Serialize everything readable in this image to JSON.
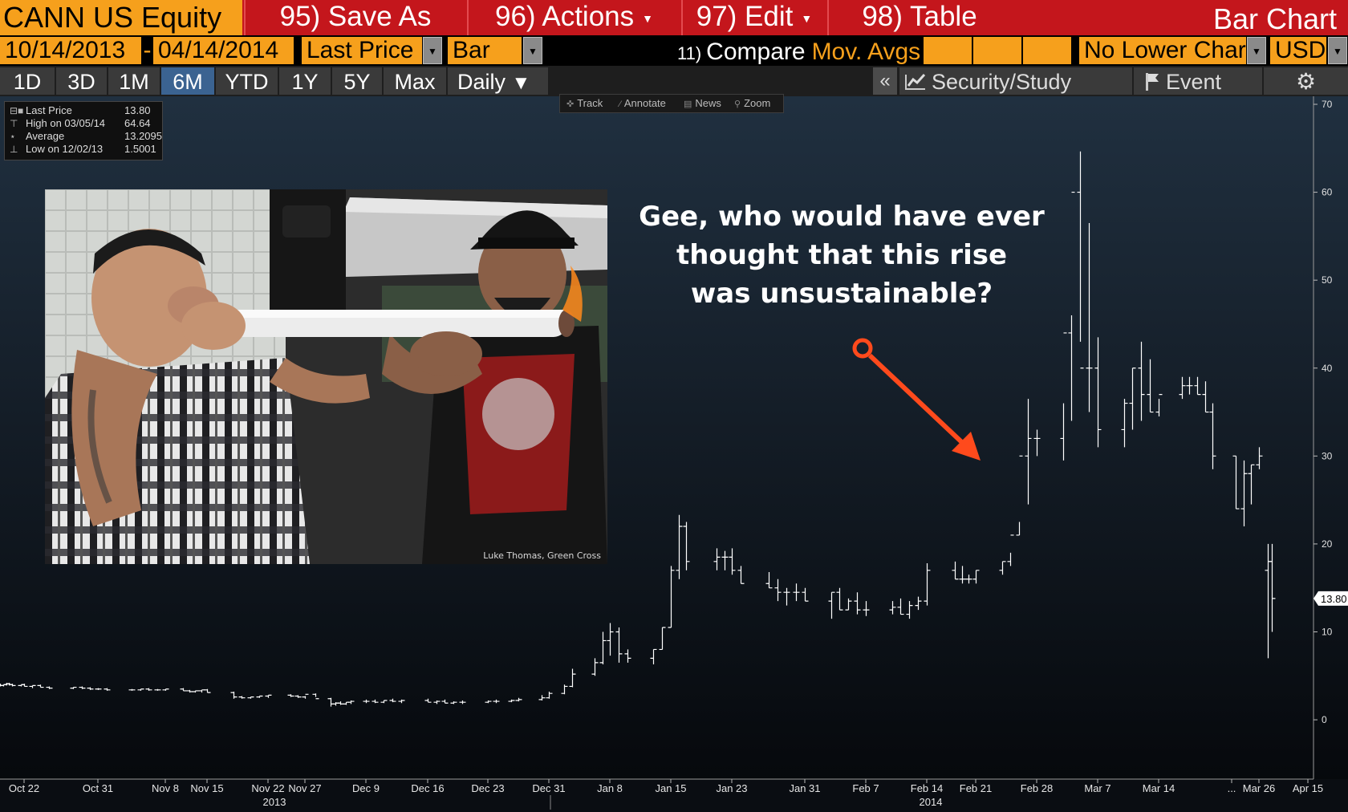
{
  "header": {
    "security": "CANN US Equity",
    "save_as": "95) Save As",
    "actions": "96) Actions",
    "edit": "97) Edit",
    "table": "98) Table",
    "chart_title": "Bar Chart"
  },
  "settings": {
    "start_date": "10/14/2013",
    "end_date": "04/14/2014",
    "field": "Last Price",
    "style": "Bar",
    "compare_num": "11)",
    "compare_label": "Compare",
    "mov_avgs": "Mov. Avgs",
    "lower_chart": "No Lower Chart",
    "currency": "USD"
  },
  "range_tabs": [
    "1D",
    "3D",
    "1M",
    "6M",
    "YTD",
    "1Y",
    "5Y",
    "Max"
  ],
  "active_tab": "6M",
  "frequency": "Daily",
  "toolbar": {
    "collapse": "«",
    "security_study": "Security/Study",
    "event": "Event",
    "settings_icon": "gear-icon"
  },
  "mini_toolbar": [
    "Track",
    "Annotate",
    "News",
    "Zoom"
  ],
  "legend": {
    "last_label": "Last Price",
    "last_value": "13.80",
    "high_label": "High on 03/05/14",
    "high_value": "64.64",
    "avg_label": "Average",
    "avg_value": "13.2095",
    "low_label": "Low on 12/02/13",
    "low_value": "1.5001"
  },
  "photo": {
    "credit": "Luke Thomas, Green Cross"
  },
  "annotation": {
    "lines": [
      "Gee, who would have ever",
      "thought that this rise",
      "was unsustainable?"
    ],
    "arrow_color": "#ff4a1c"
  },
  "colors": {
    "title_bar": "#c4161c",
    "orange": "#f6a01c",
    "active_tab": "#3b6391",
    "bar": "#ffffff"
  },
  "chart_data": {
    "type": "bar",
    "subtype": "ohlc",
    "frequency": "daily",
    "ylim": [
      -2,
      70
    ],
    "y_ticks": [
      0,
      10,
      20,
      30,
      40,
      50,
      60,
      70
    ],
    "x_tick_labels": [
      "Oct 22",
      "Oct 31",
      "Nov 8",
      "Nov 15",
      "Nov 22",
      "Nov 27",
      "Dec 9",
      "Dec 16",
      "Dec 23",
      "Dec 31",
      "Jan 8",
      "Jan 15",
      "Jan 23",
      "Jan 31",
      "Feb 7",
      "Feb 14",
      "Feb 21",
      "Feb 28",
      "Mar 7",
      "Mar 14",
      "...",
      "Mar 26",
      "Apr 15"
    ],
    "year_labels": [
      "2013",
      "2014"
    ],
    "last_price_label": "13.80",
    "grid": false,
    "series": [
      {
        "x": [
          "2013-10-14",
          "2013-10-15",
          "2013-10-16",
          "2013-10-17",
          "2013-10-18",
          "2013-10-21",
          "2013-10-22",
          "2013-10-23",
          "2013-10-24",
          "2013-10-25",
          "2013-10-28",
          "2013-10-29",
          "2013-10-30",
          "2013-10-31",
          "2013-11-01",
          "2013-11-04",
          "2013-11-05",
          "2013-11-06",
          "2013-11-07",
          "2013-11-08",
          "2013-11-11",
          "2013-11-12",
          "2013-11-13",
          "2013-11-14",
          "2013-11-15",
          "2013-11-18",
          "2013-11-19",
          "2013-11-20",
          "2013-11-21",
          "2013-11-22",
          "2013-11-25",
          "2013-11-26",
          "2013-11-27",
          "2013-11-29",
          "2013-12-02",
          "2013-12-03",
          "2013-12-04",
          "2013-12-05",
          "2013-12-06",
          "2013-12-09",
          "2013-12-10",
          "2013-12-11",
          "2013-12-12",
          "2013-12-13",
          "2013-12-16",
          "2013-12-17",
          "2013-12-18",
          "2013-12-19",
          "2013-12-20",
          "2013-12-23",
          "2013-12-24",
          "2013-12-26",
          "2013-12-27",
          "2013-12-30",
          "2013-12-31",
          "2014-01-02",
          "2014-01-03",
          "2014-01-06",
          "2014-01-07",
          "2014-01-08",
          "2014-01-09",
          "2014-01-10",
          "2014-01-13",
          "2014-01-14",
          "2014-01-15",
          "2014-01-16",
          "2014-01-17",
          "2014-01-21",
          "2014-01-22",
          "2014-01-23",
          "2014-01-24",
          "2014-01-27",
          "2014-01-28",
          "2014-01-29",
          "2014-01-30",
          "2014-01-31",
          "2014-02-03",
          "2014-02-04",
          "2014-02-05",
          "2014-02-06",
          "2014-02-07",
          "2014-02-10",
          "2014-02-11",
          "2014-02-12",
          "2014-02-13",
          "2014-02-14",
          "2014-02-18",
          "2014-02-19",
          "2014-02-20",
          "2014-02-21",
          "2014-02-24",
          "2014-02-25",
          "2014-02-26",
          "2014-02-27",
          "2014-02-28",
          "2014-03-03",
          "2014-03-04",
          "2014-03-05",
          "2014-03-06",
          "2014-03-07",
          "2014-03-10",
          "2014-03-11",
          "2014-03-12",
          "2014-03-13",
          "2014-03-14",
          "2014-03-17",
          "2014-03-18",
          "2014-03-19",
          "2014-03-20",
          "2014-03-21",
          "2014-03-24",
          "2014-03-25",
          "2014-03-26",
          "2014-03-27",
          "2014-04-10",
          "2014-04-11"
        ],
        "open": [
          4.0,
          3.9,
          4.0,
          4.1,
          4.0,
          3.9,
          4.0,
          3.8,
          3.9,
          3.7,
          3.6,
          3.7,
          3.6,
          3.5,
          3.5,
          3.4,
          3.4,
          3.5,
          3.4,
          3.4,
          3.5,
          3.3,
          3.2,
          3.3,
          3.4,
          3.1,
          2.6,
          2.5,
          2.6,
          2.7,
          2.8,
          2.7,
          2.6,
          2.9,
          2.4,
          1.8,
          1.9,
          1.8,
          2.0,
          2.1,
          2.1,
          2.0,
          2.2,
          2.1,
          2.2,
          2.0,
          2.1,
          1.9,
          2.0,
          2.0,
          2.1,
          2.1,
          2.2,
          2.3,
          2.5,
          3.0,
          3.8,
          5.2,
          6.5,
          9.0,
          10.0,
          7.5,
          7.0,
          8.0,
          10.5,
          17.0,
          22.0,
          18.0,
          18.5,
          18.5,
          17.0,
          15.5,
          15.0,
          14.5,
          14.5,
          14.5,
          13.5,
          14.5,
          12.5,
          13.5,
          12.5,
          12.5,
          12.8,
          12.0,
          13.0,
          13.5,
          17.0,
          16.0,
          16.0,
          16.0,
          17.0,
          18.0,
          21.0,
          30.0,
          32.0,
          32.0,
          44.0,
          60.0,
          40.0,
          40.0,
          33.0,
          36.0,
          40.0,
          37.0,
          35.0,
          37.0,
          38.0,
          38.0,
          37.0,
          35.0,
          30.0,
          24.0,
          28.0,
          29.0,
          17.0,
          18.0
        ],
        "high": [
          4.1,
          4.0,
          4.2,
          4.2,
          4.1,
          4.0,
          4.1,
          3.9,
          4.0,
          3.8,
          3.7,
          3.8,
          3.7,
          3.6,
          3.6,
          3.5,
          3.5,
          3.6,
          3.5,
          3.5,
          3.6,
          3.4,
          3.3,
          3.4,
          3.5,
          3.2,
          2.7,
          2.6,
          2.7,
          2.8,
          2.9,
          2.8,
          2.7,
          3.0,
          2.5,
          2.0,
          2.1,
          2.0,
          2.2,
          2.3,
          2.3,
          2.2,
          2.4,
          2.3,
          2.4,
          2.2,
          2.3,
          2.1,
          2.2,
          2.2,
          2.3,
          2.3,
          2.5,
          2.8,
          3.2,
          4.0,
          5.8,
          7.0,
          10.0,
          11.0,
          10.5,
          8.0,
          8.0,
          10.5,
          17.5,
          23.3,
          22.5,
          19.5,
          19.2,
          19.5,
          17.5,
          16.8,
          16.0,
          15.0,
          15.5,
          15.0,
          14.5,
          15.0,
          13.8,
          14.5,
          13.5,
          13.5,
          13.8,
          13.5,
          14.0,
          17.8,
          18.0,
          17.5,
          16.5,
          17.0,
          18.0,
          19.0,
          22.5,
          36.5,
          33.0,
          36.0,
          46.0,
          64.64,
          56.5,
          43.5,
          36.5,
          40.0,
          43.0,
          41.0,
          36.5,
          39.0,
          39.0,
          39.0,
          38.5,
          36.0,
          30.0,
          29.5,
          29.0,
          31.0,
          20.0,
          20.0
        ],
        "low": [
          3.8,
          3.8,
          3.9,
          3.9,
          3.8,
          3.8,
          3.8,
          3.6,
          3.7,
          3.5,
          3.5,
          3.5,
          3.4,
          3.4,
          3.3,
          3.3,
          3.3,
          3.3,
          3.3,
          3.3,
          3.3,
          3.1,
          3.1,
          3.1,
          3.1,
          2.4,
          2.4,
          2.4,
          2.5,
          2.5,
          2.6,
          2.5,
          2.4,
          2.6,
          1.5001,
          1.6,
          1.7,
          1.7,
          1.8,
          1.9,
          1.9,
          1.9,
          2.0,
          1.9,
          2.0,
          1.8,
          1.9,
          1.8,
          1.8,
          1.9,
          1.9,
          2.0,
          2.1,
          2.2,
          2.4,
          2.9,
          3.7,
          5.0,
          6.3,
          7.3,
          6.5,
          6.5,
          6.3,
          8.0,
          10.5,
          16.0,
          17.0,
          17.0,
          17.0,
          16.5,
          15.5,
          15.0,
          13.5,
          13.0,
          13.5,
          13.5,
          11.5,
          12.5,
          12.5,
          12.0,
          11.8,
          12.0,
          12.0,
          11.5,
          12.5,
          13.0,
          16.0,
          15.5,
          15.5,
          15.5,
          16.5,
          17.5,
          21.0,
          24.5,
          30.0,
          29.5,
          34.0,
          43.0,
          35.0,
          31.0,
          31.0,
          33.0,
          34.0,
          35.0,
          34.5,
          36.5,
          37.0,
          37.0,
          35.0,
          28.5,
          24.0,
          22.0,
          24.5,
          28.5,
          7.0,
          10.0
        ],
        "close": [
          3.9,
          4.0,
          4.1,
          4.0,
          3.9,
          4.0,
          3.8,
          3.9,
          3.7,
          3.6,
          3.7,
          3.6,
          3.5,
          3.5,
          3.4,
          3.4,
          3.5,
          3.4,
          3.4,
          3.5,
          3.3,
          3.2,
          3.3,
          3.4,
          3.1,
          2.6,
          2.5,
          2.6,
          2.7,
          2.8,
          2.7,
          2.6,
          2.9,
          2.4,
          1.8,
          1.9,
          1.8,
          2.0,
          2.1,
          2.1,
          2.0,
          2.2,
          2.1,
          2.2,
          2.0,
          2.1,
          1.9,
          2.0,
          2.0,
          2.1,
          2.1,
          2.2,
          2.3,
          2.5,
          3.0,
          3.8,
          5.2,
          6.5,
          9.0,
          10.0,
          7.5,
          7.0,
          8.0,
          10.5,
          17.0,
          22.0,
          18.0,
          18.5,
          18.5,
          17.0,
          15.5,
          15.0,
          14.5,
          14.5,
          14.5,
          13.5,
          14.5,
          12.5,
          13.5,
          12.5,
          12.5,
          12.8,
          12.0,
          13.0,
          13.5,
          17.0,
          16.0,
          16.0,
          16.0,
          17.0,
          18.0,
          21.0,
          30.0,
          32.0,
          32.0,
          44.0,
          60.0,
          40.0,
          40.0,
          33.0,
          36.0,
          40.0,
          37.0,
          35.0,
          37.0,
          38.0,
          38.0,
          37.0,
          35.0,
          30.0,
          24.0,
          28.0,
          29.0,
          30.0,
          18.0,
          13.8
        ]
      }
    ]
  }
}
